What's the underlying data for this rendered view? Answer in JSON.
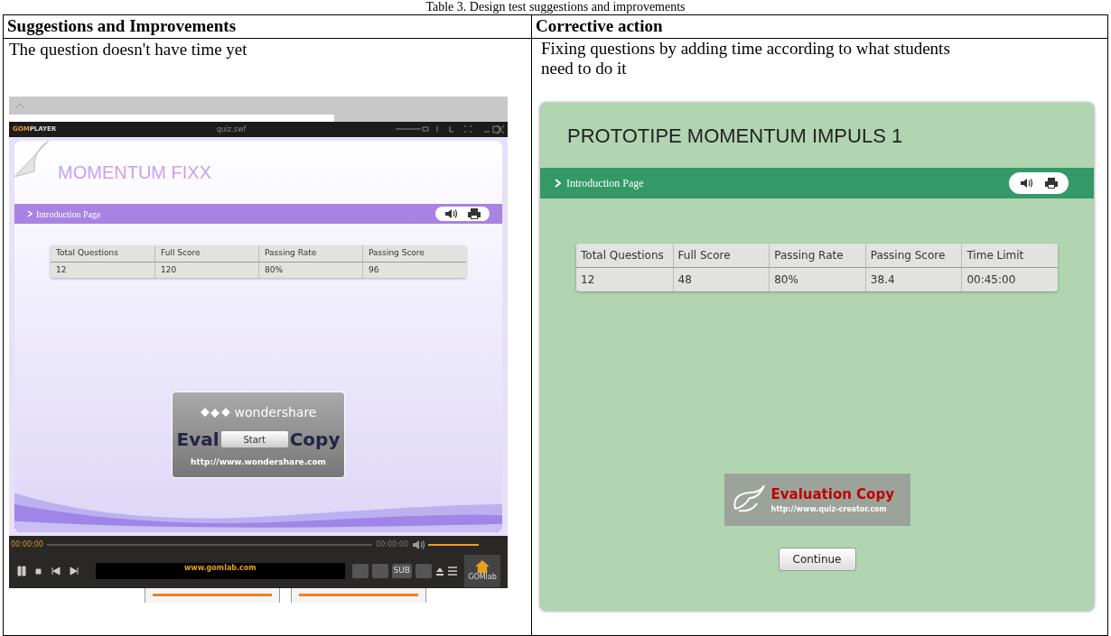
{
  "caption": "Table 3. Design test suggestions and improvements",
  "table": {
    "columns": [
      "Suggestions and Improvements",
      "Corrective action"
    ],
    "before": {
      "text": "The question doesn't have time yet",
      "player": {
        "app_prefix": "GOM",
        "app_suffix": "PLAYER",
        "file": "quiz.swf",
        "quiz": {
          "title": "MOMENTUM FIXX",
          "nav": "Introduction Page",
          "columns": [
            "Total Questions",
            "Full Score",
            "Passing Rate",
            "Passing Score"
          ],
          "values": [
            "12",
            "120",
            "80%",
            "96"
          ],
          "button": "Start"
        },
        "watermark": {
          "brand": "wondershare",
          "text_left": "Eval",
          "text_right": "Copy",
          "url": "http://www.wondershare.com"
        },
        "time_elapsed": "00:00:00",
        "time_total": "00:00:00",
        "volume": {
          "level": 1
        },
        "site": "www.gomlab.com",
        "sub": "SUB",
        "home": "GOMlab"
      }
    },
    "after": {
      "lines": [
        "Fixing questions by adding time according to what students",
        "need to do it"
      ],
      "quiz": {
        "title": "PROTOTIPE MOMENTUM IMPULS 1",
        "nav": "Introduction Page",
        "columns": [
          "Total Questions",
          "Full Score",
          "Passing Rate",
          "Passing Score",
          "Time Limit"
        ],
        "values": [
          "12",
          "48",
          "80%",
          "38.4",
          "00:45:00"
        ],
        "button": "Continue"
      },
      "watermark": {
        "title": "Evaluation Copy",
        "url": "http://www.quiz-creator.com"
      }
    }
  }
}
